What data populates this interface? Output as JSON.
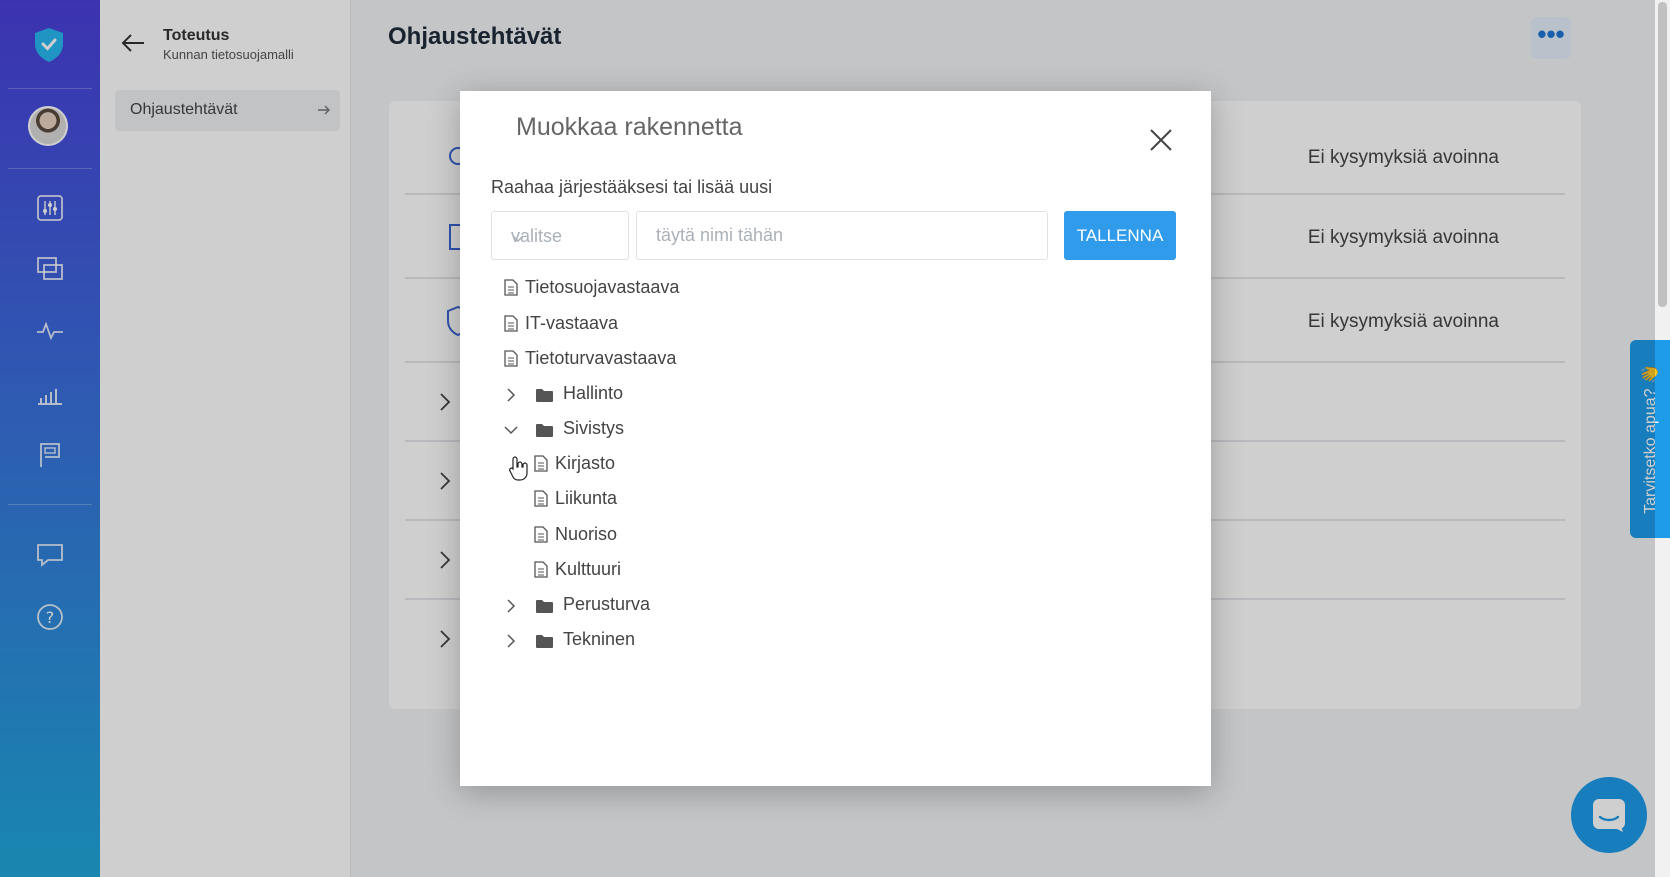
{
  "sidebar": {
    "title": "Toteutus",
    "subtitle": "Kunnan tietosuojamalli",
    "nav_item": "Ohjaustehtävät"
  },
  "main": {
    "page_title": "Ohjaustehtävät",
    "more_button": "•••",
    "rows": [
      {
        "status": "Ei kysymyksiä avoinna"
      },
      {
        "status": "Ei kysymyksiä avoinna"
      },
      {
        "status": "Ei kysymyksiä avoinna"
      }
    ]
  },
  "modal": {
    "title": "Muokkaa rakennetta",
    "hint": "Raahaa järjestääksesi tai lisää uusi",
    "select_placeholder": "valitse",
    "name_placeholder": "täytä nimi tähän",
    "save_label": "TALLENNA",
    "tree": [
      {
        "label": "Tietosuojavastaava",
        "kind": "doc"
      },
      {
        "label": "IT-vastaava",
        "kind": "doc"
      },
      {
        "label": "Tietoturvavastaava",
        "kind": "doc"
      },
      {
        "label": "Hallinto",
        "kind": "folder",
        "expanded": false
      },
      {
        "label": "Sivistys",
        "kind": "folder",
        "expanded": true
      },
      {
        "label": "Kirjasto",
        "kind": "doc",
        "child": true
      },
      {
        "label": "Liikunta",
        "kind": "doc",
        "child": true
      },
      {
        "label": "Nuoriso",
        "kind": "doc",
        "child": true
      },
      {
        "label": "Kulttuuri",
        "kind": "doc",
        "child": true
      },
      {
        "label": "Perusturva",
        "kind": "folder",
        "expanded": false
      },
      {
        "label": "Tekninen",
        "kind": "folder",
        "expanded": false
      }
    ]
  },
  "help_tab": "Tarvitsetko apua? 👋",
  "colors": {
    "primary": "#2f9bea",
    "rail_top": "#4a3fd9",
    "rail_bottom": "#1fa7d9"
  }
}
